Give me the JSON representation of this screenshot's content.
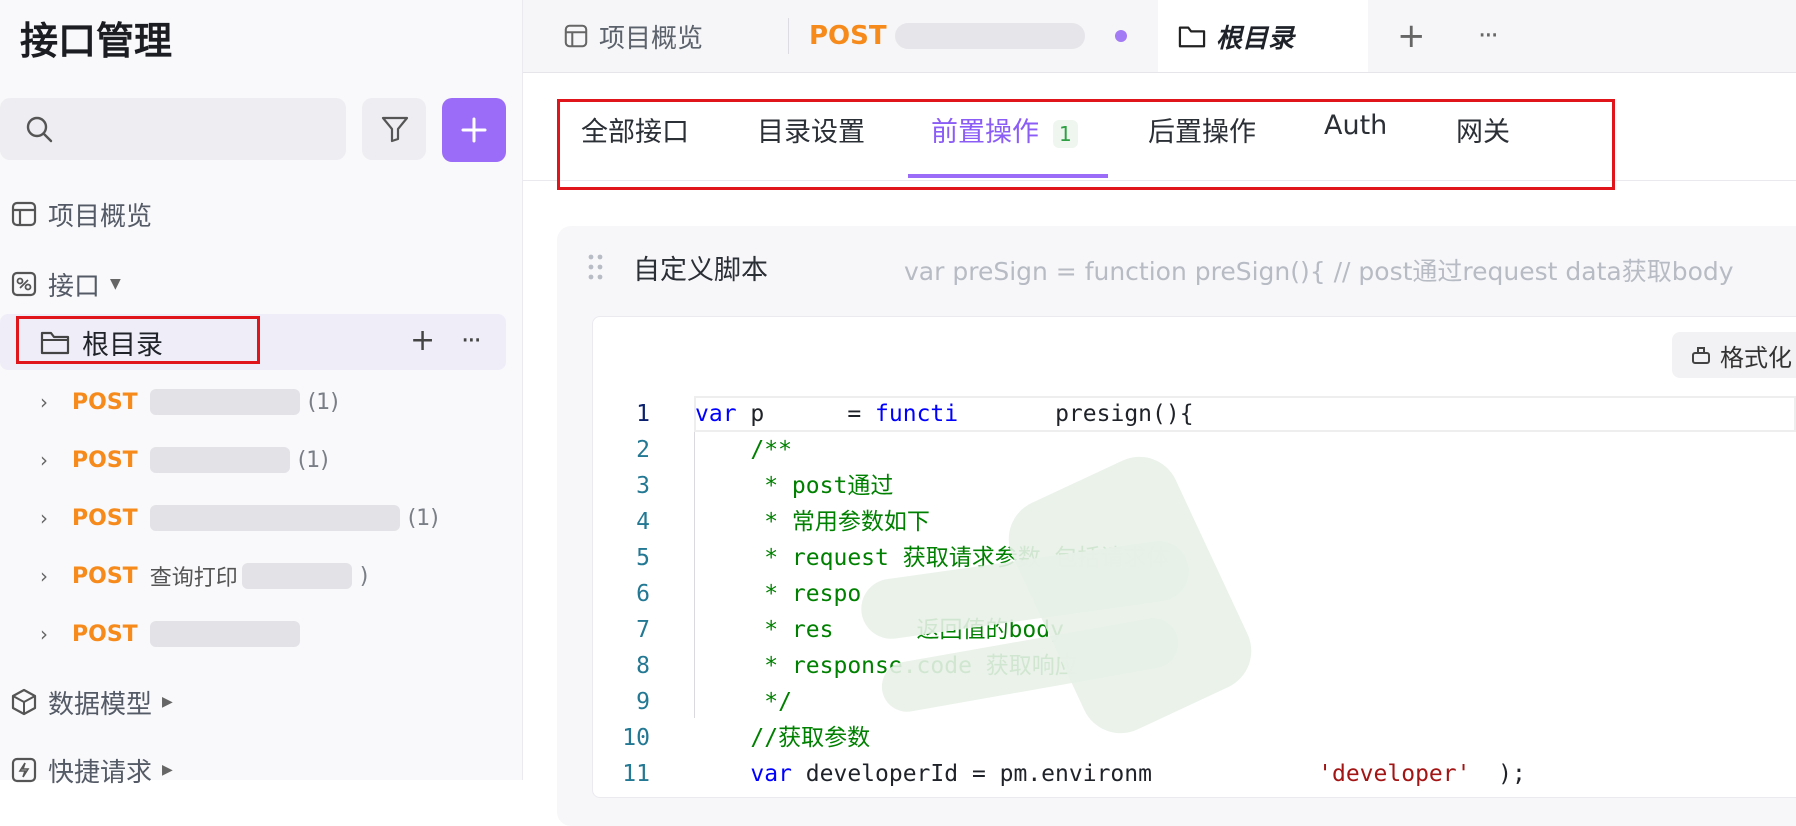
{
  "sidebar": {
    "title": "接口管理",
    "search": {
      "placeholder": ""
    },
    "nav": {
      "overview": "项目概览",
      "interfaces": "接口",
      "data_models": "数据模型",
      "quick_requests": "快捷请求"
    },
    "root": {
      "label": "根目录",
      "add": "+",
      "more": "···"
    },
    "tree": [
      {
        "method": "POST",
        "count": "(1)"
      },
      {
        "method": "POST",
        "count": "(1)"
      },
      {
        "method": "POST",
        "count": "(1)"
      },
      {
        "method": "POST",
        "count": ")"
      },
      {
        "method": "POST",
        "count": ""
      }
    ],
    "tree_item_4_text": "查询打印",
    "add_color": "#9b6cf7"
  },
  "topbar": {
    "tabs": [
      {
        "label": "项目概览",
        "icon": "layout-icon"
      },
      {
        "label": "POST",
        "icon": ""
      },
      {
        "label": "根目录",
        "icon": "folder-icon",
        "active": true
      }
    ],
    "add": "+",
    "more": "···"
  },
  "subtabs": {
    "items": [
      {
        "label": "全部接口"
      },
      {
        "label": "目录设置"
      },
      {
        "label": "前置操作",
        "badge": "1",
        "active": true
      },
      {
        "label": "后置操作"
      },
      {
        "label": "Auth"
      },
      {
        "label": "网关"
      }
    ],
    "active_color": "#8b5cf6"
  },
  "script_panel": {
    "title": "自定义脚本",
    "preview": "var preSign = function preSign(){ // post通过request data获取body",
    "format_label": "格式化"
  },
  "code": {
    "lines": [
      {
        "no": "1",
        "parts": [
          [
            "kw",
            "var"
          ],
          [
            "id",
            " p"
          ],
          [
            "id",
            "     "
          ],
          [
            "id",
            " = "
          ],
          [
            "kw",
            "functi"
          ],
          [
            "id",
            "       "
          ],
          [
            "id",
            "presign"
          ],
          [
            "id",
            "(){"
          ]
        ]
      },
      {
        "no": "2",
        "parts": [
          [
            "cm",
            "    /**"
          ]
        ]
      },
      {
        "no": "3",
        "parts": [
          [
            "cm",
            "     * post通过"
          ]
        ]
      },
      {
        "no": "4",
        "parts": [
          [
            "cm",
            "     * 常用参数如下"
          ]
        ]
      },
      {
        "no": "5",
        "parts": [
          [
            "cm",
            "     * request 获取请求参数 包括请求体"
          ]
        ]
      },
      {
        "no": "6",
        "parts": [
          [
            "cm",
            "     * respo"
          ]
        ]
      },
      {
        "no": "7",
        "parts": [
          [
            "cm",
            "     * res      返回值的body"
          ]
        ]
      },
      {
        "no": "8",
        "parts": [
          [
            "cm",
            "     * response.code 获取响应"
          ]
        ]
      },
      {
        "no": "9",
        "parts": [
          [
            "cm",
            "     */"
          ]
        ]
      },
      {
        "no": "10",
        "parts": [
          [
            "cm",
            "    //获取参数"
          ]
        ]
      },
      {
        "no": "11",
        "parts": [
          [
            "kw",
            "    var"
          ],
          [
            "id",
            " developerId = pm.environm"
          ],
          [
            "id",
            "            "
          ],
          [
            "str",
            "'developer'"
          ],
          [
            "id",
            "  );"
          ]
        ]
      }
    ]
  }
}
